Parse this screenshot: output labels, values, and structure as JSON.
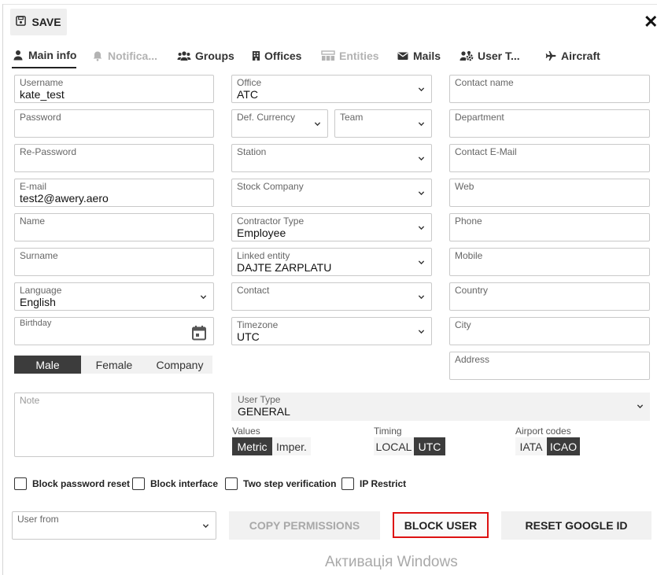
{
  "toolbar": {
    "save_label": "SAVE",
    "close_label": "✕"
  },
  "tabs": [
    {
      "label": "Main info",
      "icon": "user-icon",
      "state": "active"
    },
    {
      "label": "Notifica...",
      "icon": "bell-icon",
      "state": "disabled"
    },
    {
      "label": "Groups",
      "icon": "users-icon",
      "state": "normal"
    },
    {
      "label": "Offices",
      "icon": "building-icon",
      "state": "normal"
    },
    {
      "label": "Entities",
      "icon": "entities-icon",
      "state": "disabled"
    },
    {
      "label": "Mails",
      "icon": "envelope-icon",
      "state": "normal"
    },
    {
      "label": "User T...",
      "icon": "users-cog-icon",
      "state": "normal"
    },
    {
      "label": "Aircraft",
      "icon": "plane-icon",
      "state": "normal"
    }
  ],
  "col1": {
    "username": {
      "label": "Username",
      "value": "kate_test"
    },
    "password": {
      "label": "Password",
      "value": ""
    },
    "repassword": {
      "label": "Re-Password",
      "value": ""
    },
    "email": {
      "label": "E-mail",
      "value": "test2@awery.aero"
    },
    "name": {
      "label": "Name",
      "value": ""
    },
    "surname": {
      "label": "Surname",
      "value": ""
    },
    "language": {
      "label": "Language",
      "value": "English"
    },
    "birthday": {
      "label": "Birthday",
      "value": ""
    },
    "gender": {
      "options": [
        "Male",
        "Female",
        "Company"
      ],
      "selected": "Male"
    },
    "note": {
      "label": "Note",
      "value": ""
    }
  },
  "col2": {
    "office": {
      "label": "Office",
      "value": "ATC"
    },
    "currency": {
      "label": "Def. Currency",
      "value": ""
    },
    "team": {
      "label": "Team",
      "value": ""
    },
    "station": {
      "label": "Station",
      "value": ""
    },
    "stock_company": {
      "label": "Stock Company",
      "value": ""
    },
    "contractor_type": {
      "label": "Contractor Type",
      "value": "Employee"
    },
    "linked_entity": {
      "label": "Linked entity",
      "value": "DAJTE ZARPLATU"
    },
    "contact": {
      "label": "Contact",
      "value": ""
    },
    "timezone": {
      "label": "Timezone",
      "value": "UTC"
    }
  },
  "col3": {
    "contact_name": {
      "label": "Contact name",
      "value": ""
    },
    "department": {
      "label": "Department",
      "value": ""
    },
    "contact_email": {
      "label": "Contact E-Mail",
      "value": ""
    },
    "web": {
      "label": "Web",
      "value": ""
    },
    "phone": {
      "label": "Phone",
      "value": ""
    },
    "mobile": {
      "label": "Mobile",
      "value": ""
    },
    "country": {
      "label": "Country",
      "value": ""
    },
    "city": {
      "label": "City",
      "value": ""
    },
    "address": {
      "label": "Address",
      "value": ""
    }
  },
  "user_type": {
    "label": "User Type",
    "value": "GENERAL"
  },
  "values_toggle": {
    "label": "Values",
    "options": [
      "Metric",
      "Imper."
    ],
    "selected": "Metric"
  },
  "timing_toggle": {
    "label": "Timing",
    "options": [
      "LOCAL",
      "UTC"
    ],
    "selected": "UTC"
  },
  "airport_toggle": {
    "label": "Airport codes",
    "options": [
      "IATA",
      "ICAO"
    ],
    "selected": "ICAO"
  },
  "checkboxes": [
    {
      "label": "Block password reset",
      "checked": false
    },
    {
      "label": "Block interface",
      "checked": false
    },
    {
      "label": "Two step verification",
      "checked": false
    },
    {
      "label": "IP Restrict",
      "checked": false
    }
  ],
  "user_from": {
    "label": "User from",
    "value": ""
  },
  "actions": {
    "copy_permissions": "COPY PERMISSIONS",
    "block_user": "BLOCK USER",
    "reset_google_id": "RESET GOOGLE ID"
  },
  "watermark": "Активація Windows"
}
